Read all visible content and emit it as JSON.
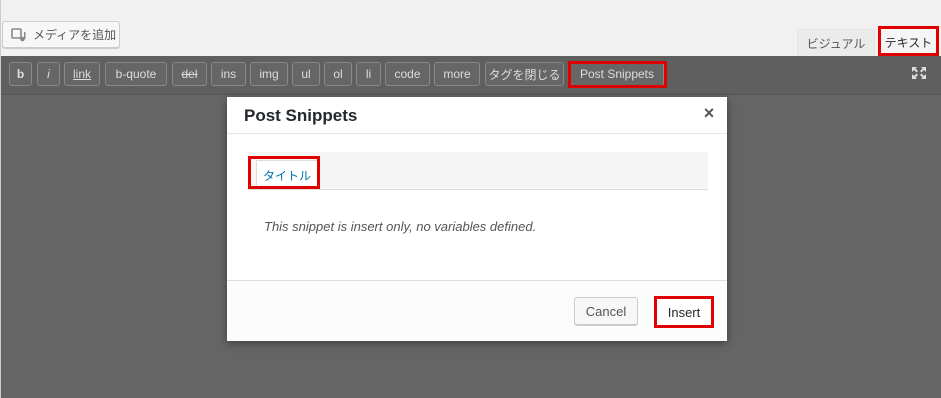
{
  "header": {
    "media_button_label": "メディアを追加",
    "tab_visual": "ビジュアル",
    "tab_text": "テキスト"
  },
  "toolbar": {
    "buttons": [
      "b",
      "i",
      "link",
      "b-quote",
      "del",
      "ins",
      "img",
      "ul",
      "ol",
      "li",
      "code",
      "more",
      "タグを閉じる",
      "Post Snippets"
    ]
  },
  "modal": {
    "title": "Post Snippets",
    "close_glyph": "×",
    "snippet_tab": "タイトル",
    "message": "This snippet is insert only, no variables defined.",
    "cancel_label": "Cancel",
    "insert_label": "Insert"
  },
  "colors": {
    "highlight": "#e00000",
    "link": "#0073aa"
  }
}
